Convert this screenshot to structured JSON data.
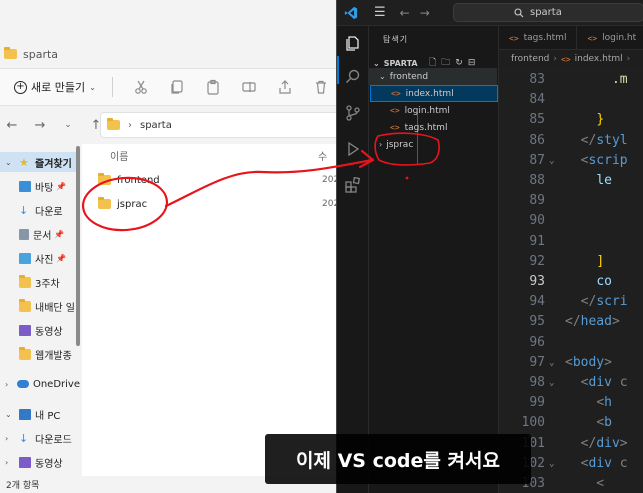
{
  "explorer": {
    "title": "sparta",
    "toolbar": {
      "new_label": "새로 만들기"
    },
    "address": {
      "folder": "sparta"
    },
    "nav": {
      "items": [
        {
          "label": "즐겨찾기",
          "type": "group"
        },
        {
          "label": "바탕",
          "pinned": true
        },
        {
          "label": "다운로",
          "pinned": true
        },
        {
          "label": "문서",
          "pinned": true
        },
        {
          "label": "사진",
          "pinned": true
        },
        {
          "label": "3주차"
        },
        {
          "label": "내배단 일"
        },
        {
          "label": "동영상"
        },
        {
          "label": "웹개발종"
        },
        {
          "label": "OneDrive",
          "type": "group"
        },
        {
          "label": "내 PC",
          "type": "group"
        },
        {
          "label": "다운로드"
        },
        {
          "label": "동영상"
        }
      ]
    },
    "content": {
      "col_name": "이름",
      "col_date": "수",
      "files": [
        {
          "name": "frontend",
          "date": "202"
        },
        {
          "name": "jsprac",
          "date": "202"
        }
      ]
    },
    "status": "2개 항목"
  },
  "vscode": {
    "search_text": "sparta",
    "sidebar": {
      "title": "탐색기",
      "root": "SPARTA",
      "tree": [
        {
          "label": "frontend",
          "kind": "folder",
          "expanded": true
        },
        {
          "label": "index.html",
          "kind": "file",
          "active": true
        },
        {
          "label": "login.html",
          "kind": "file"
        },
        {
          "label": "tags.html",
          "kind": "file"
        },
        {
          "label": "jsprac",
          "kind": "folder",
          "expanded": false
        }
      ]
    },
    "tabs": [
      {
        "label": "tags.html"
      },
      {
        "label": "login.ht"
      }
    ],
    "breadcrumb": {
      "folder": "frontend",
      "file": "index.html"
    },
    "editor": {
      "current_line": 93,
      "lines": [
        {
          "n": "83",
          "code": "      .m"
        },
        {
          "n": "84",
          "code": ""
        },
        {
          "n": "85",
          "code": "    }"
        },
        {
          "n": "86",
          "code": "  </styl"
        },
        {
          "n": "87",
          "code": "  <scrip"
        },
        {
          "n": "88",
          "code": "    le"
        },
        {
          "n": "89",
          "code": ""
        },
        {
          "n": "90",
          "code": ""
        },
        {
          "n": "91",
          "code": ""
        },
        {
          "n": "92",
          "code": "    ]"
        },
        {
          "n": "93",
          "code": "    co"
        },
        {
          "n": "94",
          "code": "  </scri"
        },
        {
          "n": "95",
          "code": "</head>"
        },
        {
          "n": "96",
          "code": ""
        },
        {
          "n": "97",
          "code": "<body>"
        },
        {
          "n": "98",
          "code": "  <div c"
        },
        {
          "n": "99",
          "code": "    <h"
        },
        {
          "n": "100",
          "code": "    <b"
        },
        {
          "n": "101",
          "code": "  </div>"
        },
        {
          "n": "102",
          "code": "  <div c"
        },
        {
          "n": "103",
          "code": "    <"
        }
      ]
    }
  },
  "caption": "이제 VS code를 켜서요",
  "colors": {
    "annotation_red": "#e8141b",
    "vscode_accent": "#0078d4",
    "html_icon": "#e37933"
  }
}
